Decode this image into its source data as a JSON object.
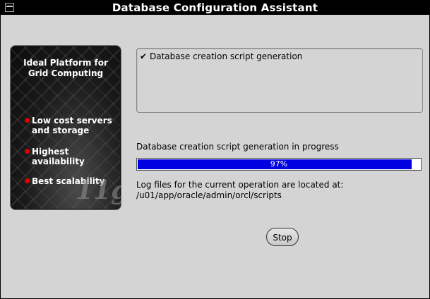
{
  "window": {
    "title": "Database Configuration Assistant"
  },
  "brand_panel": {
    "headline": [
      "Ideal Platform for",
      "Grid Computing"
    ],
    "bullets": [
      "Low cost servers",
      "and storage",
      "Highest availability",
      "Best scalability"
    ],
    "logo_text": "11g",
    "bullet_color": "#e00000"
  },
  "steps": [
    {
      "check": "✔",
      "label": "Database creation script generation",
      "status": "done"
    }
  ],
  "progress": {
    "label": "Database creation script generation in progress",
    "percent": 97,
    "percent_text": "97%",
    "fill_color": "#0000e0"
  },
  "log": {
    "line1": "Log files for the current operation are located at:",
    "line2": "/u01/app/oracle/admin/orcl/scripts"
  },
  "buttons": {
    "stop": "Stop"
  }
}
